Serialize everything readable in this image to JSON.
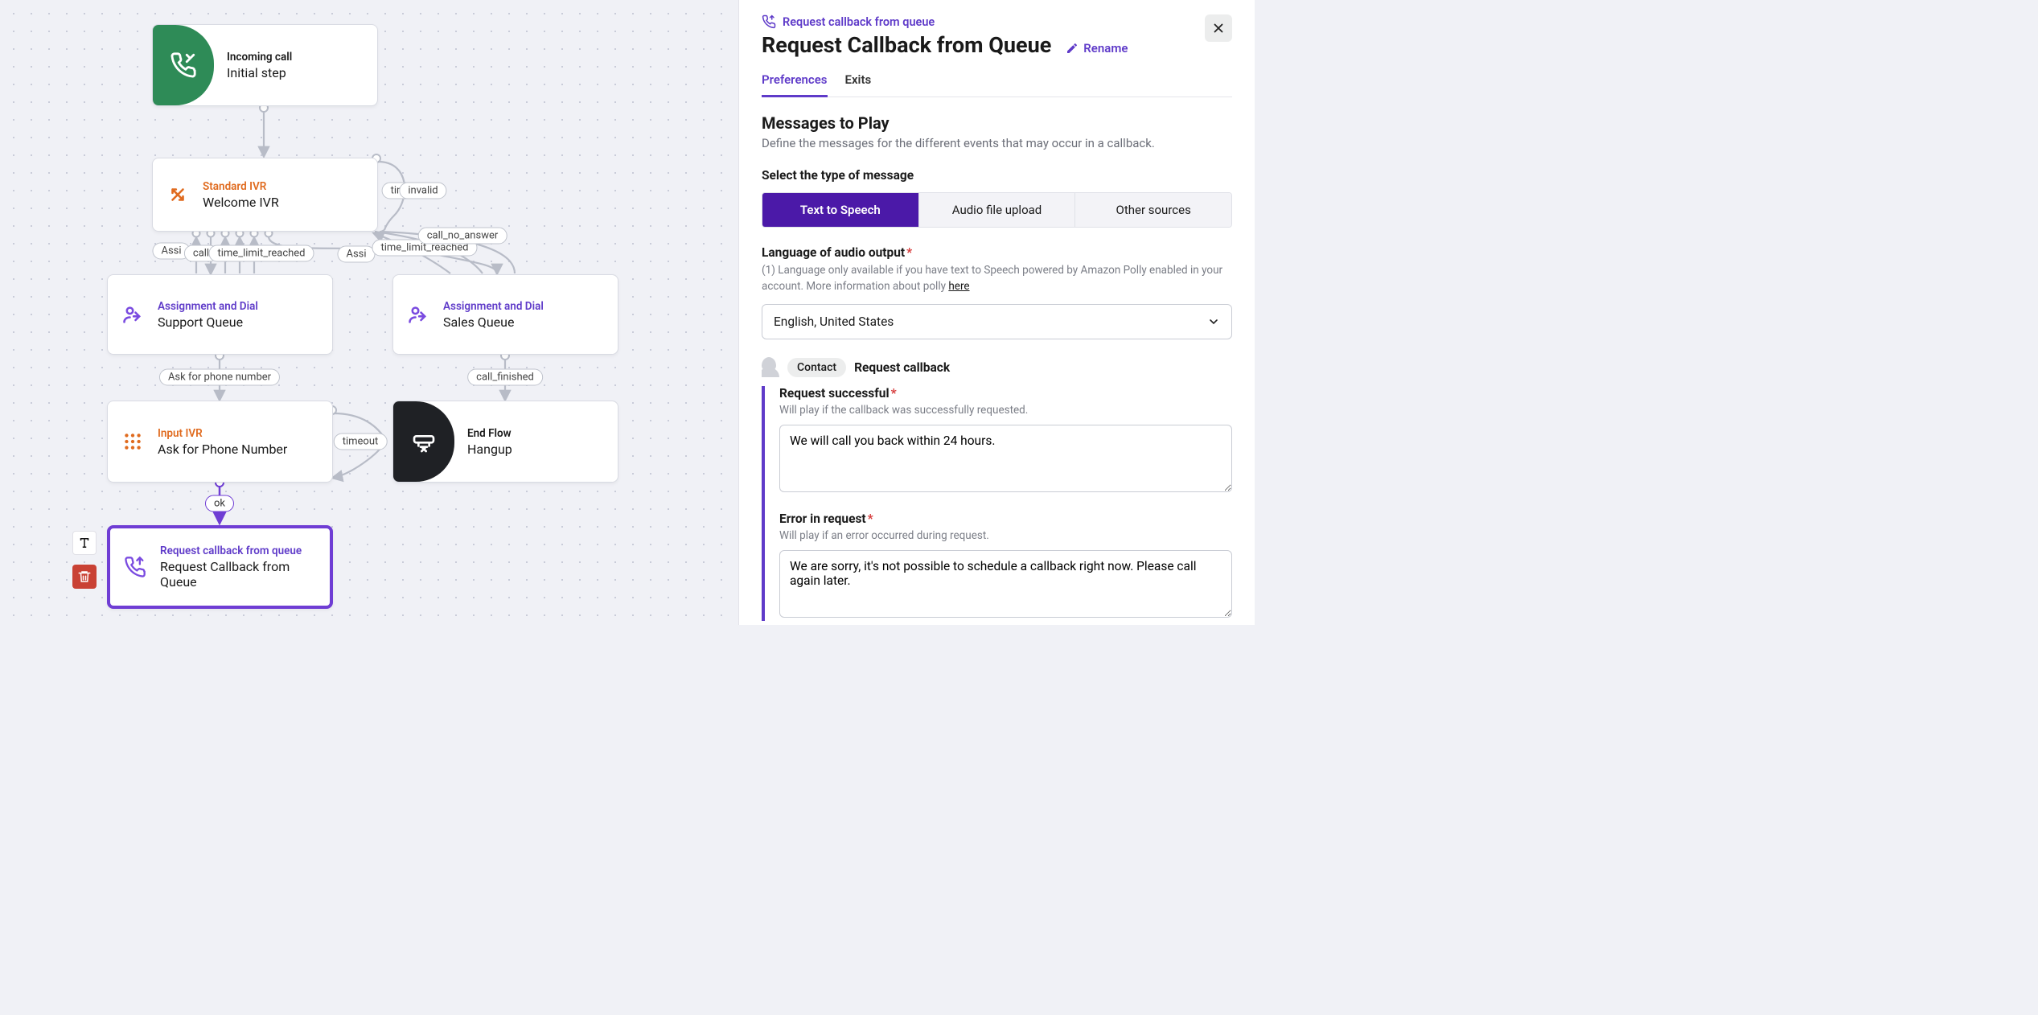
{
  "canvas": {
    "nodes": {
      "initial": {
        "kicker": "Incoming call",
        "title": "Initial step"
      },
      "welcome": {
        "kicker": "Standard IVR",
        "title": "Welcome IVR"
      },
      "support": {
        "kicker": "Assignment and Dial",
        "title": "Support Queue"
      },
      "sales": {
        "kicker": "Assignment and Dial",
        "title": "Sales Queue"
      },
      "askphone": {
        "kicker": "Input IVR",
        "title": "Ask for Phone Number"
      },
      "hangup": {
        "kicker": "End Flow",
        "title": "Hangup"
      },
      "callback": {
        "kicker": "Request callback from queue",
        "title": "Request Callback from Queue"
      }
    },
    "edges": {
      "tim": "tim",
      "invalid": "invalid",
      "assi1": "Assi",
      "call": "call",
      "time_limit_reached1": "time_limit_reached",
      "assi2": "Assi",
      "time_limit_reached2": "time_limit_reached",
      "call_no_answer": "call_no_answer",
      "ask_for_phone_number": "Ask for phone number",
      "call_finished": "call_finished",
      "timeout": "timeout",
      "ok": "ok"
    }
  },
  "panel": {
    "breadcrumb": "Request callback from queue",
    "title": "Request Callback from Queue",
    "rename": "Rename",
    "tabs": {
      "preferences": "Preferences",
      "exits": "Exits"
    },
    "messages_heading": "Messages to Play",
    "messages_sub": "Define the messages for the different events that may occur in a callback.",
    "type_label": "Select the type of message",
    "type_options": {
      "tts": "Text to Speech",
      "upload": "Audio file upload",
      "other": "Other sources"
    },
    "lang_label": "Language of audio output",
    "lang_helper_prefix": "(1) Language only available if you have text to Speech powered by Amazon Polly enabled in your account. More information about polly ",
    "lang_helper_link": "here",
    "lang_value": "English, United States",
    "contact_pill": "Contact",
    "request_callback_label": "Request callback",
    "success": {
      "title": "Request successful",
      "sub": "Will play if the callback was successfully requested.",
      "value": "We will call you back within 24 hours."
    },
    "error": {
      "title": "Error in request",
      "sub": "Will play if an error occurred during request.",
      "value": "We are sorry, it's not possible to schedule a callback right now. Please call again later."
    }
  }
}
